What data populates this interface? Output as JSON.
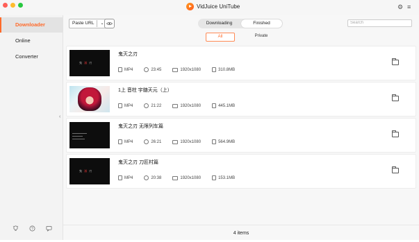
{
  "window": {
    "title": "VidJuice UniTube",
    "traffic_colors": [
      "#ff5f57",
      "#febc2e",
      "#28c840"
    ],
    "accent": "#ff6a2a"
  },
  "titlebar_icons": {
    "settings": "gear-icon",
    "menu": "hamburger-menu-icon"
  },
  "sidebar": {
    "items": [
      {
        "label": "Downloader",
        "active": true
      },
      {
        "label": "Online",
        "active": false
      },
      {
        "label": "Converter",
        "active": false
      }
    ],
    "bottom_icons": [
      "bulb-icon",
      "help-icon",
      "chat-icon"
    ]
  },
  "toolbar": {
    "paste_url_label": "Paste URL",
    "tabs": [
      {
        "label": "Downloading",
        "active": false
      },
      {
        "label": "Finished",
        "active": true
      }
    ],
    "search_placeholder": "Search"
  },
  "filters": {
    "all": "All",
    "private": "Private"
  },
  "videos": [
    {
      "title": "鬼灭之刃",
      "format": "MP4",
      "duration": "23:45",
      "resolution": "1920x1080",
      "size": "310.8MB"
    },
    {
      "title": "1上 音柱 宇髄天元（上）",
      "format": "MP4",
      "duration": "21:22",
      "resolution": "1920x1080",
      "size": "445.1MB"
    },
    {
      "title": "鬼灭之刃 无限列车篇",
      "format": "MP4",
      "duration": "26:21",
      "resolution": "1920x1080",
      "size": "564.9MB"
    },
    {
      "title": "鬼灭之刃 刀匠村篇",
      "format": "MP4",
      "duration": "20:38",
      "resolution": "1920x1080",
      "size": "153.1MB"
    }
  ],
  "footer": {
    "count_label": "4 items"
  }
}
